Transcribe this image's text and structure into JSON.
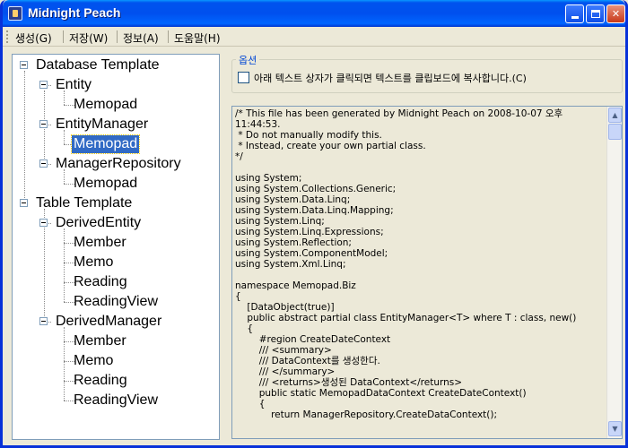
{
  "window": {
    "title": "Midnight Peach"
  },
  "menu": {
    "items": [
      {
        "label": "생성(G)"
      },
      {
        "label": "저장(W)"
      },
      {
        "label": "정보(A)"
      },
      {
        "label": "도움말(H)"
      }
    ]
  },
  "tree": {
    "nodes": [
      {
        "label": "Database Template"
      },
      {
        "label": "Entity"
      },
      {
        "label": "Memopad"
      },
      {
        "label": "EntityManager"
      },
      {
        "label": "Memopad"
      },
      {
        "label": "ManagerRepository"
      },
      {
        "label": "Memopad"
      },
      {
        "label": "Table Template"
      },
      {
        "label": "DerivedEntity"
      },
      {
        "label": "Member"
      },
      {
        "label": "Memo"
      },
      {
        "label": "Reading"
      },
      {
        "label": "ReadingView"
      },
      {
        "label": "DerivedManager"
      },
      {
        "label": "Member"
      },
      {
        "label": "Memo"
      },
      {
        "label": "Reading"
      },
      {
        "label": "ReadingView"
      }
    ],
    "selected_index": 4
  },
  "options": {
    "legend": "옵션",
    "copy_checkbox_label": "아래 텍스트 상자가 클릭되면 텍스트를 클립보드에 복사합니다.(C)",
    "copy_checkbox_checked": false
  },
  "code": {
    "text": "/* This file has been generated by Midnight Peach on 2008-10-07 오후 11:44:53.\n * Do not manually modify this.\n * Instead, create your own partial class.\n*/\n\nusing System;\nusing System.Collections.Generic;\nusing System.Data.Linq;\nusing System.Data.Linq.Mapping;\nusing System.Linq;\nusing System.Linq.Expressions;\nusing System.Reflection;\nusing System.ComponentModel;\nusing System.Xml.Linq;\n\nnamespace Memopad.Biz\n{\n    [DataObject(true)]\n    public abstract partial class EntityManager<T> where T : class, new()\n    {\n        #region CreateDateContext\n        /// <summary>\n        /// DataContext를 생성한다.\n        /// </summary>\n        /// <returns>생성된 DataContext</returns>\n        public static MemopadDataContext CreateDateContext()\n        {\n            return ManagerRepository.CreateDataContext();"
  },
  "colors": {
    "titlebar": "#0053ee",
    "selection": "#316ac5",
    "window_bg": "#ece9d8",
    "legend_text": "#0046d5"
  }
}
